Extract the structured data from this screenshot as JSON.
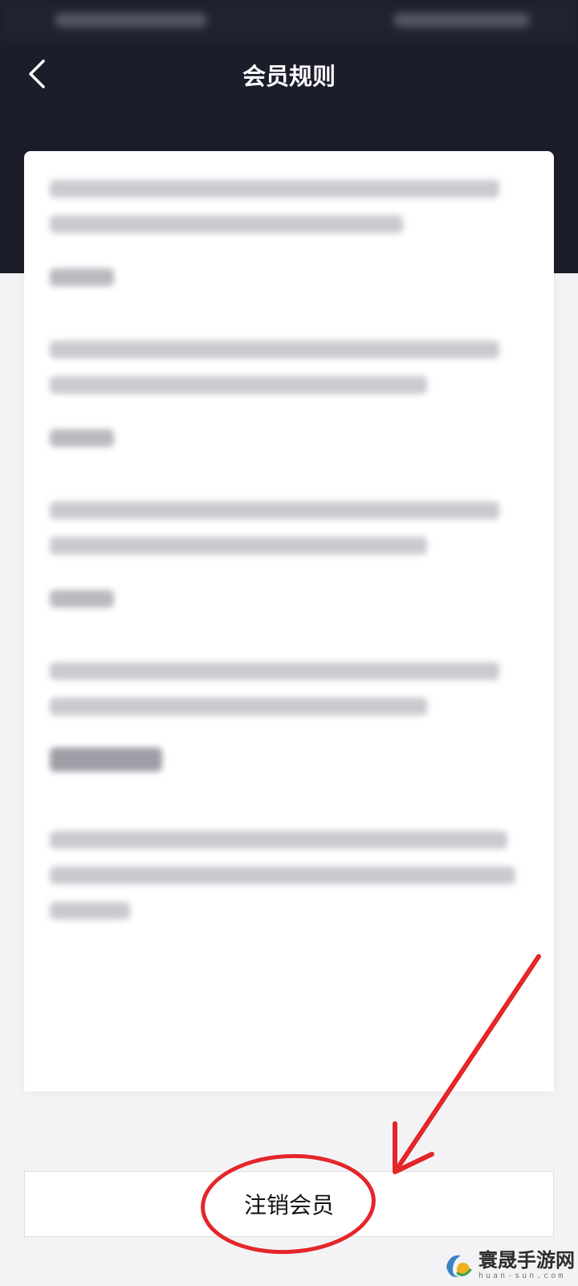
{
  "nav": {
    "title": "会员规则",
    "back_icon": "chevron-left-icon"
  },
  "footer": {
    "cancel_label": "注销会员"
  },
  "watermark": {
    "title": "寰晟手游网",
    "subtitle": "huan-sun.com"
  },
  "colors": {
    "header": "#1b1d2b",
    "background": "#f3f3f5",
    "annotation": "#e4262a"
  }
}
